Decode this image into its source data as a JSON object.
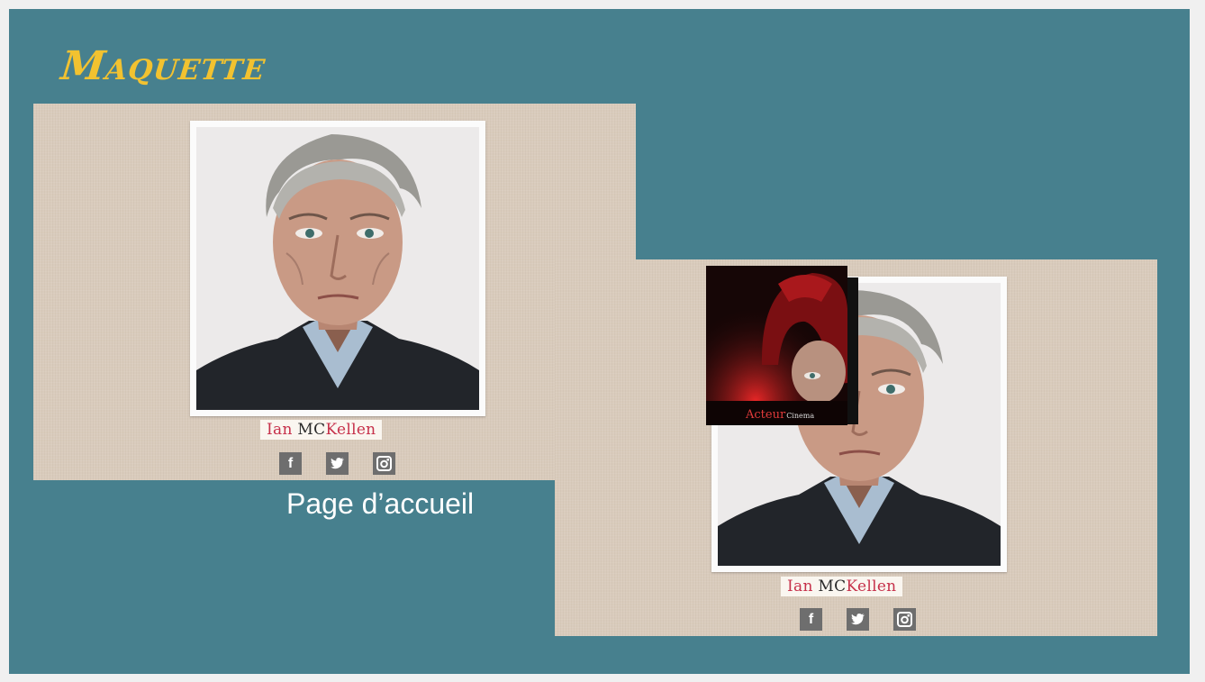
{
  "slide": {
    "title": "Maquette",
    "caption": "Page d’accueil",
    "colors": {
      "background": "#47808e",
      "title": "#f2c230",
      "mockup_bg": "#d9cbbc",
      "name_red": "#c6304a"
    }
  },
  "home_mockup": {
    "portrait_icon": "portrait-photo",
    "name": {
      "first": "Ian",
      "mc": "MC",
      "last": "Kellen"
    },
    "social": [
      {
        "icon": "facebook-icon",
        "glyph": "f"
      },
      {
        "icon": "twitter-icon",
        "glyph": "🐦"
      },
      {
        "icon": "instagram-icon",
        "glyph": "◘"
      }
    ]
  },
  "hover_mockup": {
    "portrait_icon": "portrait-photo",
    "overlay": {
      "icon": "magneto-helmet-image",
      "caption_main": "Acteur",
      "caption_sub": "Cinema"
    },
    "name": {
      "first": "Ian",
      "mc": "MC",
      "last": "Kellen"
    },
    "social": [
      {
        "icon": "facebook-icon",
        "glyph": "f"
      },
      {
        "icon": "twitter-icon",
        "glyph": "🐦"
      },
      {
        "icon": "instagram-icon",
        "glyph": "◘"
      }
    ]
  }
}
